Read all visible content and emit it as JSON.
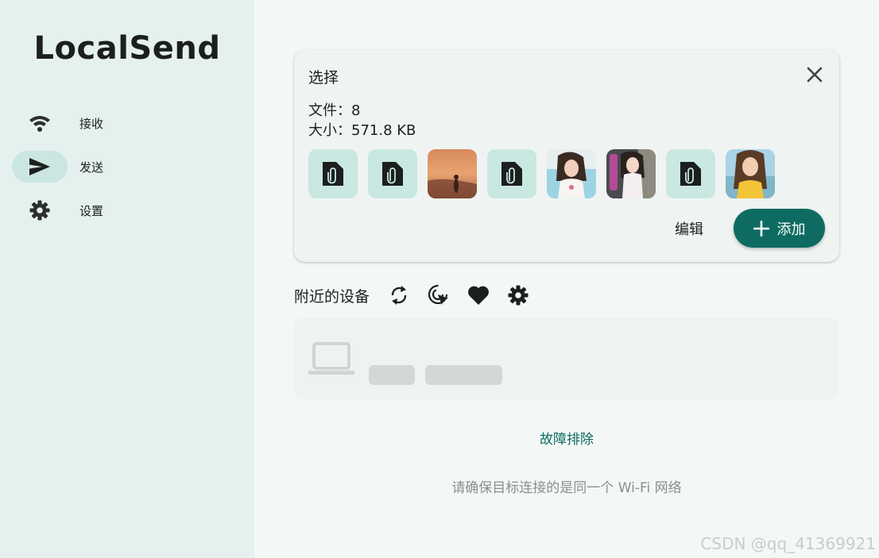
{
  "app": {
    "title": "LocalSend"
  },
  "sidebar": {
    "items": [
      {
        "label": "接收",
        "icon": "wifi-icon",
        "active": false
      },
      {
        "label": "发送",
        "icon": "send-icon",
        "active": true
      },
      {
        "label": "设置",
        "icon": "gear-icon",
        "active": false
      }
    ]
  },
  "selection": {
    "title": "选择",
    "files_line": "文件：8",
    "size_line": "大小：571.8 KB",
    "thumbnails": [
      {
        "kind": "file",
        "icon": "file-attachment-icon"
      },
      {
        "kind": "file",
        "icon": "file-attachment-icon"
      },
      {
        "kind": "image",
        "desc": "sunset-beach-photo"
      },
      {
        "kind": "file",
        "icon": "file-attachment-icon"
      },
      {
        "kind": "image",
        "desc": "portrait-photo"
      },
      {
        "kind": "image",
        "desc": "portrait-photo"
      },
      {
        "kind": "file",
        "icon": "file-attachment-icon"
      },
      {
        "kind": "image",
        "desc": "portrait-photo"
      }
    ],
    "edit_label": "编辑",
    "add_label": "添加"
  },
  "nearby": {
    "title": "附近的设备",
    "tools": [
      "refresh-icon",
      "target-scan-icon",
      "heart-icon",
      "gear-icon"
    ]
  },
  "troubleshoot_label": "故障排除",
  "hint": "请确保目标连接的是同一个 Wi-Fi 网络",
  "watermark": "CSDN @qq_41369921",
  "colors": {
    "accent": "#0d6b61",
    "sidebar_bg": "#e5f1ef",
    "page_bg": "#f3f8f7"
  }
}
